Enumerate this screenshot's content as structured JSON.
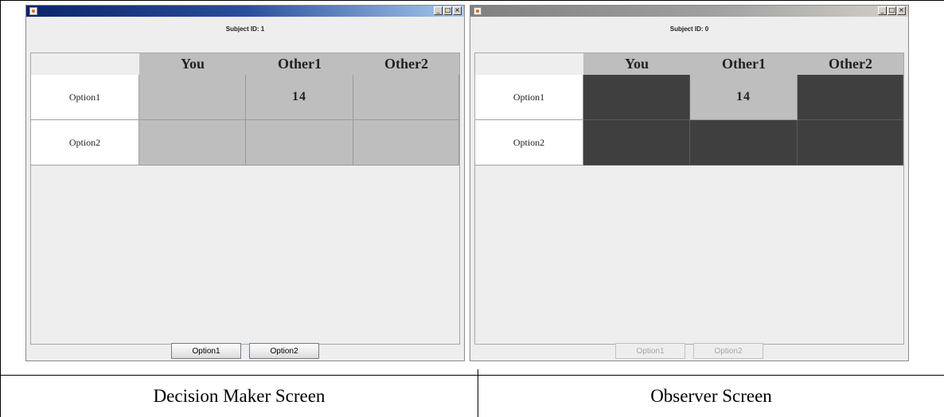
{
  "decision_maker": {
    "subject_id": "Subject ID: 1",
    "columns": [
      "You",
      "Other1",
      "Other2"
    ],
    "rows": [
      {
        "label": "Option1",
        "cells": [
          "",
          "14",
          ""
        ]
      },
      {
        "label": "Option2",
        "cells": [
          "",
          "",
          ""
        ]
      }
    ],
    "buttons": [
      "Option1",
      "Option2"
    ],
    "caption": "Decision Maker Screen",
    "controls": [
      "_",
      "□",
      "×"
    ]
  },
  "observer": {
    "subject_id": "Subject ID: 0",
    "columns": [
      "You",
      "Other1",
      "Other2"
    ],
    "rows": [
      {
        "label": "Option1",
        "cells": [
          "",
          "14",
          ""
        ]
      },
      {
        "label": "Option2",
        "cells": [
          "",
          "",
          ""
        ]
      }
    ],
    "buttons": [
      "Option1",
      "Option2"
    ],
    "caption": "Observer Screen",
    "controls": [
      "_",
      "□",
      "×"
    ]
  },
  "colors": {
    "revealed_cell": "#bebebe",
    "hidden_cell": "#3f3f3f",
    "active_titlebar": "#0a246a",
    "inactive_titlebar": "#808080"
  }
}
